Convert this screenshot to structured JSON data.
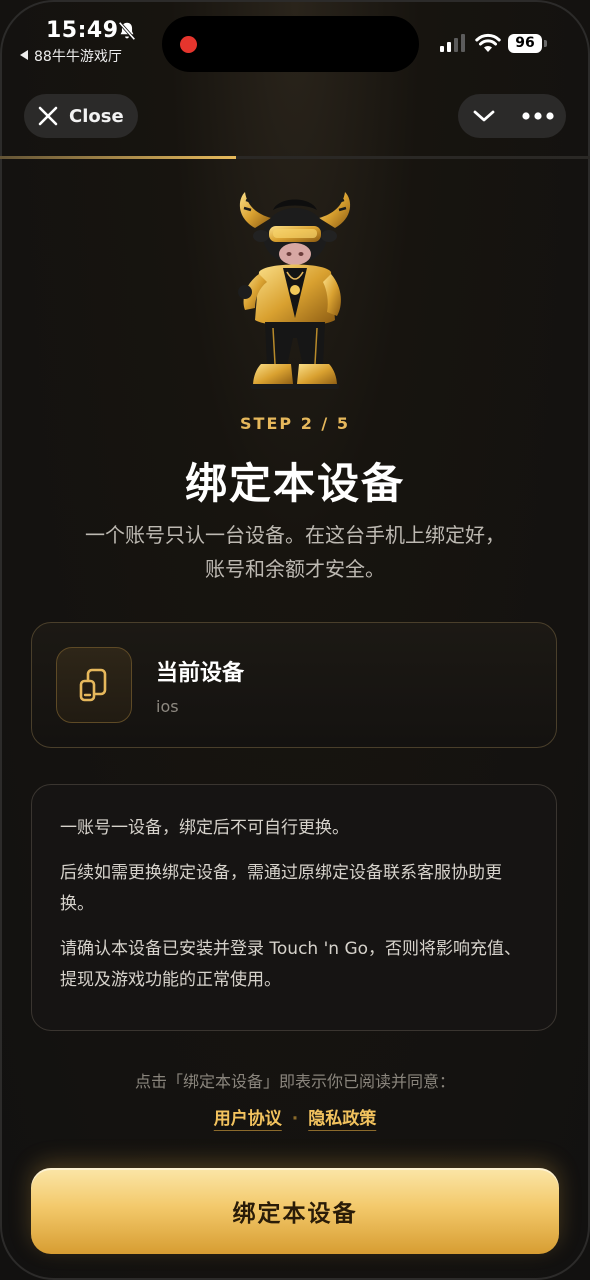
{
  "status_bar": {
    "time": "15:49",
    "back_app": "88牛牛游戏厅",
    "battery": "96"
  },
  "nav": {
    "close_label": "Close"
  },
  "progress": {
    "fraction": 0.4
  },
  "step": {
    "label": "STEP 2 / 5"
  },
  "page": {
    "title": "绑定本设备",
    "subtitle_line1": "一个账号只认一台设备。在这台手机上绑定好，",
    "subtitle_line2": "账号和余额才安全。"
  },
  "device_card": {
    "title": "当前设备",
    "subtitle": "ios",
    "icon": "device-link-icon"
  },
  "notice": {
    "paragraphs": [
      "一账号一设备，绑定后不可自行更换。",
      "后续如需更换绑定设备，需通过原绑定设备联系客服协助更换。",
      "请确认本设备已安装并登录 Touch 'n Go，否则将影响充值、提现及游戏功能的正常使用。"
    ]
  },
  "agreement": {
    "text": "点击「绑定本设备」即表示你已阅读并同意：",
    "user_agreement": "用户协议",
    "separator": "·",
    "privacy_policy": "隐私政策"
  },
  "cta": {
    "label": "绑定本设备"
  },
  "colors": {
    "accent": "#e6b85c",
    "background": "#121110",
    "record_dot": "#e5352d"
  }
}
